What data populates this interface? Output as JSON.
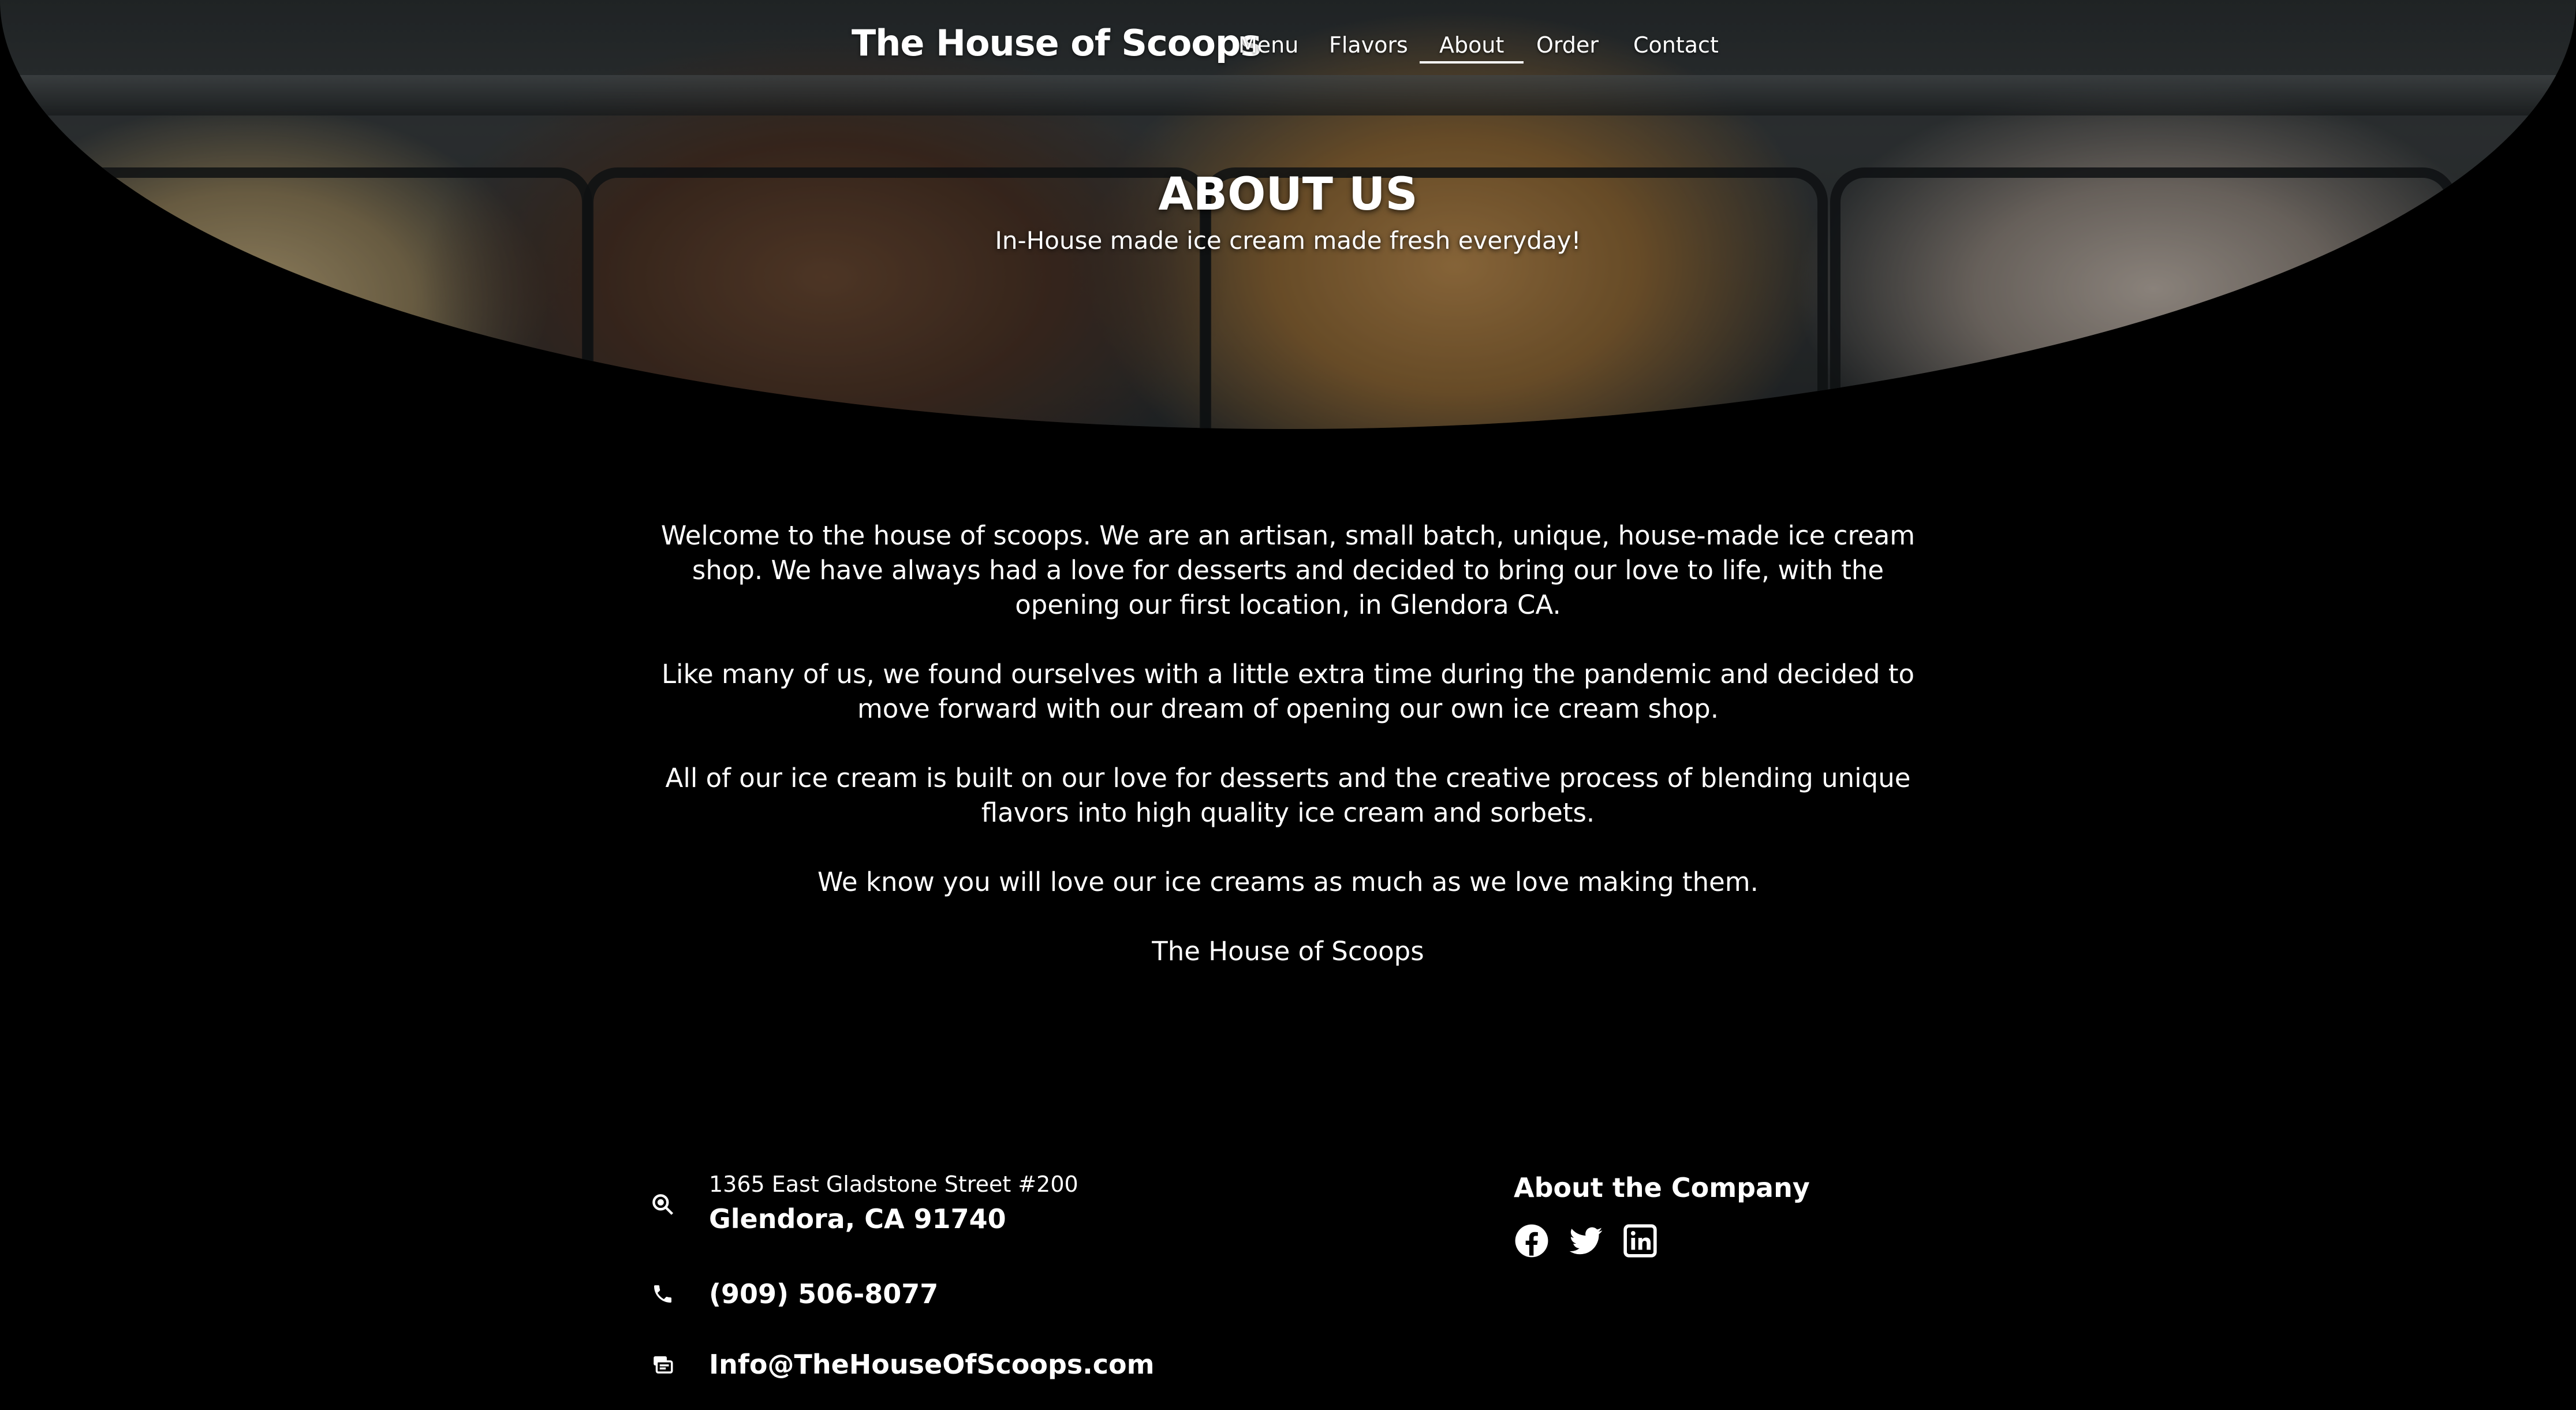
{
  "nav": {
    "brand": "The House of Scoops",
    "links": [
      {
        "label": "Menu"
      },
      {
        "label": "Flavors"
      },
      {
        "label": "About"
      },
      {
        "label": "Order"
      },
      {
        "label": "Contact"
      }
    ],
    "active": "About"
  },
  "hero": {
    "title": "ABOUT US",
    "subtitle": "In-House made ice cream made fresh everyday!"
  },
  "about": {
    "paragraphs": [
      "Welcome to the house of scoops. We are an artisan, small batch, unique, house-made ice cream shop. We have always had a love for desserts and decided to bring our love to life, with the opening our first location, in Glendora CA.",
      "Like many of us, we found ourselves with a little extra time during the pandemic and decided to move forward with our dream of opening our own ice cream shop.",
      "All of our ice cream is built on our love for desserts and the creative process of blending unique flavors into high quality ice cream and sorbets.",
      "We know you will love our ice creams as much as we love making them.",
      "The House of Scoops"
    ]
  },
  "footer": {
    "address_line1": "1365 East Gladstone Street #200",
    "address_line2": "Glendora, CA 91740",
    "phone": "(909) 506-8077",
    "email": "Info@TheHouseOfScoops.com",
    "about_heading": "About the Company",
    "social_icons": [
      "facebook-icon",
      "twitter-icon",
      "linkedin-icon"
    ],
    "contact_icons": [
      "map-search-icon",
      "phone-icon",
      "email-icon"
    ]
  },
  "colors": {
    "background": "#000000",
    "text": "#ffffff"
  }
}
